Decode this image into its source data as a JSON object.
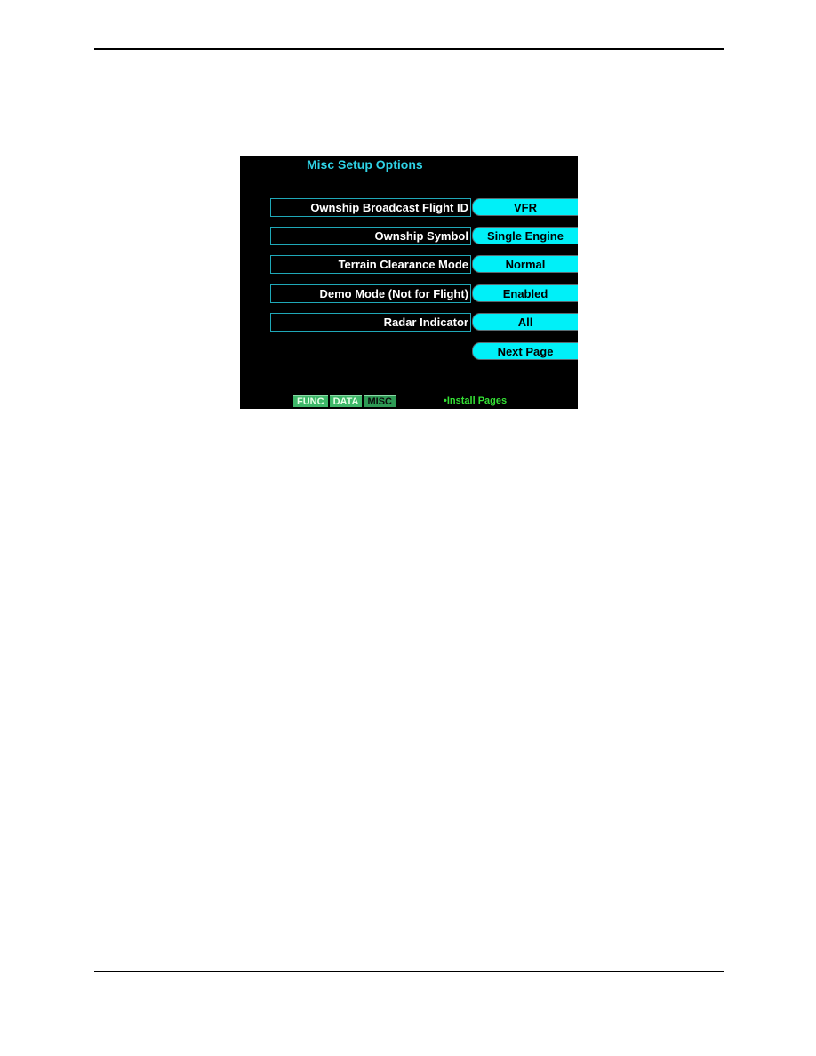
{
  "screen": {
    "title": "Misc Setup Options",
    "options": [
      {
        "label": "Ownship Broadcast Flight ID",
        "value": "VFR"
      },
      {
        "label": "Ownship Symbol",
        "value": "Single Engine"
      },
      {
        "label": "Terrain Clearance Mode",
        "value": "Normal"
      },
      {
        "label": "Demo Mode (Not for Flight)",
        "value": "Enabled"
      },
      {
        "label": "Radar Indicator",
        "value": "All"
      }
    ],
    "next_page_label": "Next Page",
    "tabs": [
      {
        "label": "FUNC",
        "active": false
      },
      {
        "label": "DATA",
        "active": false
      },
      {
        "label": "MISC",
        "active": true
      }
    ],
    "install_pages_label": "•Install Pages"
  },
  "colors": {
    "title": "#2fd3e6",
    "value_button": "#00f0f8",
    "tab": "#3fb86a",
    "install_text": "#34e034"
  }
}
